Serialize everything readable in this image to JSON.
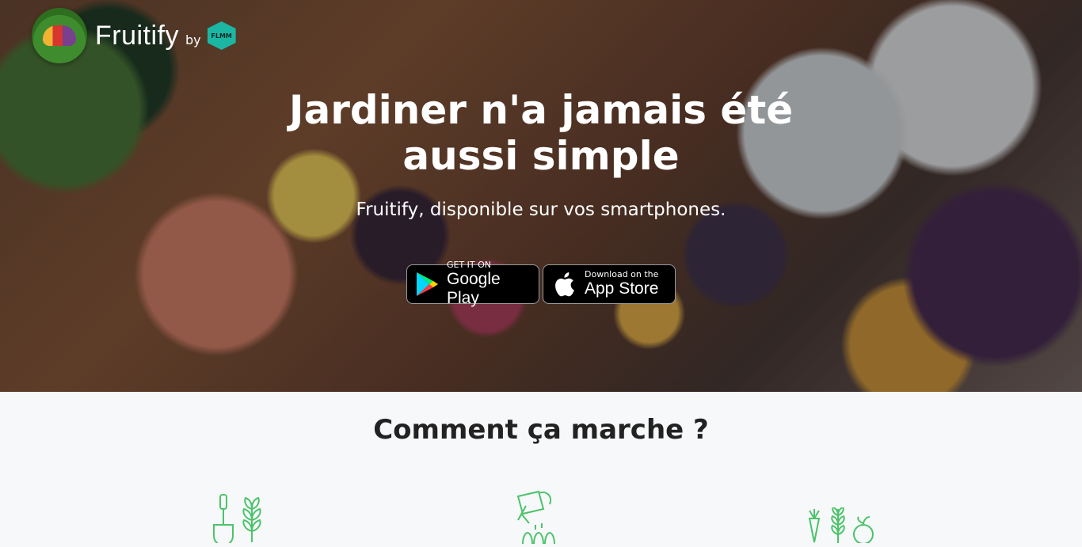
{
  "brand": {
    "name": "Fruitify",
    "by": "by",
    "partner": "FLMM"
  },
  "hero": {
    "title": "Jardiner n'a jamais été aussi simple",
    "subtitle": "Fruitify, disponible sur vos smartphones."
  },
  "stores": {
    "google": {
      "small": "GET IT ON",
      "big": "Google Play"
    },
    "apple": {
      "small": "Download on the",
      "big": "App Store"
    }
  },
  "how": {
    "title": "Comment ça marche ?",
    "steps": [
      {
        "icon": "garden-tools-icon"
      },
      {
        "icon": "watering-can-icon"
      },
      {
        "icon": "harvest-vegetables-icon"
      }
    ]
  },
  "colors": {
    "accent": "#4cc36a",
    "dark_text": "#222222",
    "section_bg": "#f7f8fa"
  }
}
